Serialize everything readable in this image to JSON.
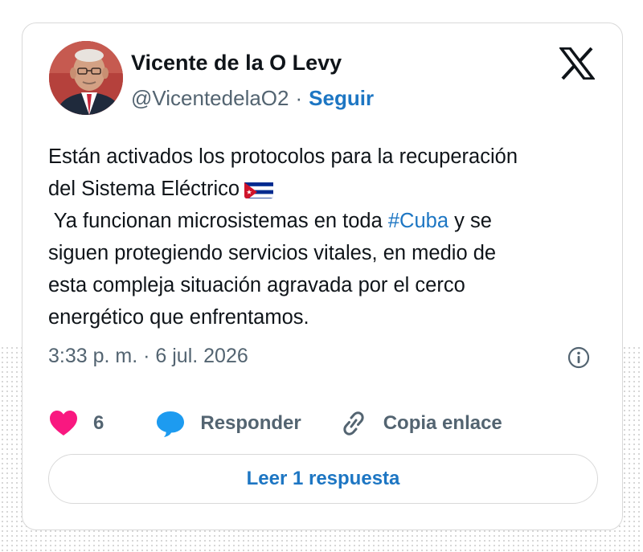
{
  "author": {
    "name": "Vicente de la O Levy",
    "handle": "@VicentedelaO2",
    "separator": "·",
    "follow_label": "Seguir"
  },
  "tweet": {
    "line1": "Están activados los protocolos para la recuperación",
    "line2": "del Sistema Eléctrico",
    "line3_before": " Ya funcionan microsistemas en toda ",
    "hashtag": "#Cuba",
    "line3_after": " y se",
    "line4": "siguen protegiendo servicios vitales, en medio de",
    "line5": "esta compleja situación agravada por el cerco",
    "line6": "energético que enfrentamos."
  },
  "meta": {
    "timestamp": "3:33 p. m. · 6 jul. 2026"
  },
  "actions": {
    "like_count": "6",
    "reply_label": "Responder",
    "copy_label": "Copia enlace"
  },
  "read_replies_label": "Leer 1 respuesta",
  "icons": {
    "logo": "x-logo-icon",
    "flag": "cuba-flag-icon",
    "info": "info-icon",
    "like": "heart-icon",
    "reply": "speech-bubble-icon",
    "copy": "link-icon"
  },
  "colors": {
    "link": "#1d76c3",
    "text": "#0f1419",
    "muted": "#536471",
    "heart": "#f91880",
    "reply_bubble": "#1d9bf0"
  }
}
